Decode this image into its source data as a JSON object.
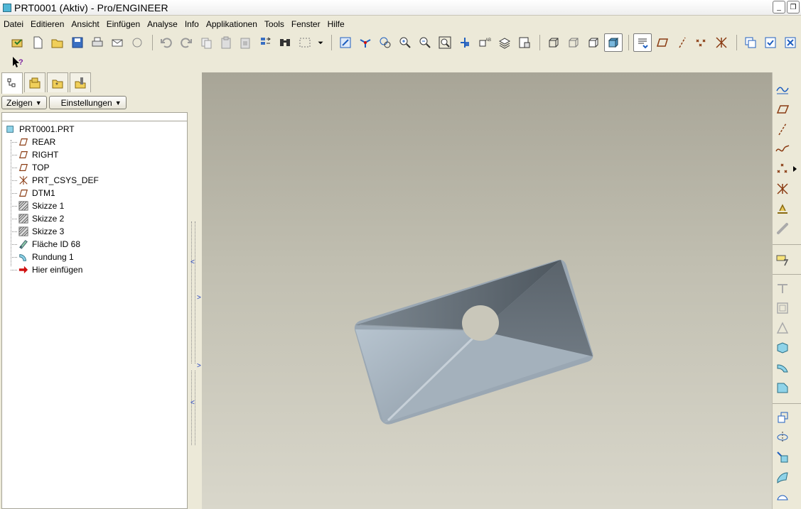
{
  "window": {
    "title": "PRT0001 (Aktiv) - Pro/ENGINEER",
    "minimize_glyph": "_",
    "restore_glyph": "❐"
  },
  "menu": [
    {
      "label": "Datei"
    },
    {
      "label": "Editieren"
    },
    {
      "label": "Ansicht"
    },
    {
      "label": "Einfügen"
    },
    {
      "label": "Analyse"
    },
    {
      "label": "Info"
    },
    {
      "label": "Applikationen"
    },
    {
      "label": "Tools"
    },
    {
      "label": "Fenster"
    },
    {
      "label": "Hilfe"
    }
  ],
  "left_panel": {
    "show_button": "Zeigen",
    "settings_button": "Einstellungen",
    "tree": {
      "root": "PRT0001.PRT",
      "items": [
        {
          "label": "REAR",
          "icon": "datum-plane-icon"
        },
        {
          "label": "RIGHT",
          "icon": "datum-plane-icon"
        },
        {
          "label": "TOP",
          "icon": "datum-plane-icon"
        },
        {
          "label": "PRT_CSYS_DEF",
          "icon": "csys-icon"
        },
        {
          "label": "DTM1",
          "icon": "datum-plane-icon"
        },
        {
          "label": "Skizze 1",
          "icon": "sketch-icon"
        },
        {
          "label": "Skizze 2",
          "icon": "sketch-icon"
        },
        {
          "label": "Skizze 3",
          "icon": "sketch-icon"
        },
        {
          "label": "Fläche ID 68",
          "icon": "surface-icon"
        },
        {
          "label": "Rundung 1",
          "icon": "round-icon"
        },
        {
          "label": "Hier einfügen",
          "icon": "insert-here-arrow-icon"
        }
      ]
    }
  },
  "colors": {
    "datum": "#8a3b12",
    "insert_arrow": "#d01010",
    "toolbar_blue": "#1f5fbf",
    "model_face": "#a9b6c2",
    "model_dark": "#5f6870"
  }
}
